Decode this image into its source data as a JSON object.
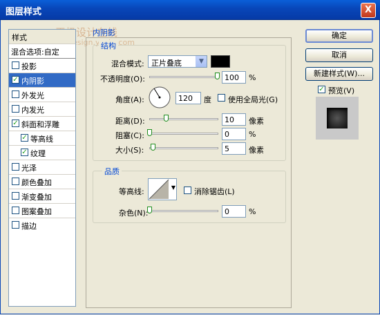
{
  "window": {
    "title": "图层样式",
    "close": "X"
  },
  "watermark": {
    "line1": "天极设计在线",
    "line2": "design.yesky.com"
  },
  "style_list": {
    "header": "样式",
    "blend_options": "混合选项:自定",
    "items": [
      {
        "label": "投影",
        "checked": false
      },
      {
        "label": "内阴影",
        "checked": true,
        "selected": true
      },
      {
        "label": "外发光",
        "checked": false
      },
      {
        "label": "内发光",
        "checked": false
      },
      {
        "label": "斜面和浮雕",
        "checked": true
      },
      {
        "label": "等高线",
        "checked": true,
        "indent": true
      },
      {
        "label": "纹理",
        "checked": true,
        "indent": true
      },
      {
        "label": "光泽",
        "checked": false
      },
      {
        "label": "颜色叠加",
        "checked": false
      },
      {
        "label": "渐变叠加",
        "checked": false
      },
      {
        "label": "图案叠加",
        "checked": false
      },
      {
        "label": "描边",
        "checked": false
      }
    ],
    "check_mark": "✓"
  },
  "panel": {
    "title": "内阴影",
    "structure": {
      "title": "结构",
      "blend_mode_label": "混合模式:",
      "blend_mode_value": "正片叠底",
      "shadow_color": "#000000",
      "opacity_label": "不透明度(O):",
      "opacity": "100",
      "opacity_unit": "%",
      "angle_label": "角度(A):",
      "angle": "120",
      "angle_unit": "度",
      "global_light_label": "使用全局光(G)",
      "global_light_checked": false,
      "distance_label": "距离(D):",
      "distance": "10",
      "distance_unit": "像素",
      "choke_label": "阻塞(C):",
      "choke": "0",
      "choke_unit": "%",
      "size_label": "大小(S):",
      "size": "5",
      "size_unit": "像素"
    },
    "quality": {
      "title": "品质",
      "contour_label": "等高线:",
      "anti_alias_label": "消除锯齿(L)",
      "anti_alias_checked": false,
      "noise_label": "杂色(N):",
      "noise": "0",
      "noise_unit": "%"
    }
  },
  "buttons": {
    "ok": "确定",
    "cancel": "取消",
    "new_style": "新建样式(W)...",
    "preview": "预览(V)",
    "preview_checked": true
  }
}
